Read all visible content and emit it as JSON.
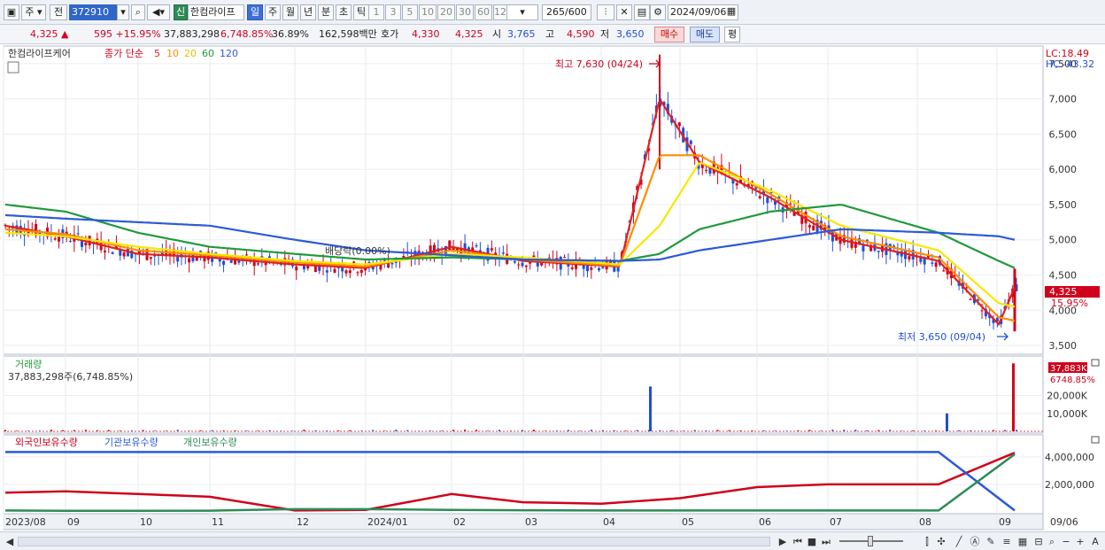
{
  "toolbar": {
    "market_label": "주",
    "prev_label": "전",
    "code": "372910",
    "new_badge": "신",
    "stock_name": "한컴라이프",
    "periods": [
      "일",
      "주",
      "월",
      "년",
      "분",
      "초",
      "틱"
    ],
    "active_period": "일",
    "intervals": [
      "1",
      "3",
      "5",
      "10",
      "20",
      "30",
      "60",
      "120"
    ],
    "count": "265",
    "count_max": "/600",
    "date": "2024/09/06"
  },
  "quote": {
    "price": "4,325",
    "change": "595",
    "change_pct": "+15.95%",
    "volume": "37,883,298",
    "volume_ratio": "6,748.85%",
    "turnover": "36.89%",
    "amount": "162,598백만",
    "bid_label": "호가",
    "bid1": "4,330",
    "bid2": "4,325",
    "open_label": "시",
    "open": "3,765",
    "high_label": "고",
    "high": "4,590",
    "low_label": "저",
    "low": "3,650",
    "buy_label": "매수",
    "sell_label": "매도",
    "avg_label": "평"
  },
  "price_panel": {
    "title": "한컴라이프케어",
    "ma_label": "종가 단순",
    "ma_periods": [
      "5",
      "10",
      "20",
      "60",
      "120"
    ],
    "ma_colors": [
      "#e02020",
      "#ff8c00",
      "#f5e800",
      "#1f9a3a",
      "#2c5ad8"
    ],
    "lc": "LC:18.49",
    "hc": "HC:-43.32",
    "high_note": "최고 7,630 (04/24)",
    "low_note": "최저 3,650 (09/04)",
    "dividend_note": "배당락(0.00%)",
    "current_price_tag": "4,325",
    "current_pct_tag": "15.95%",
    "y_ticks": [
      "7,500",
      "7,000",
      "6,500",
      "6,000",
      "5,500",
      "5,000",
      "4,500",
      "4,000",
      "3,500"
    ]
  },
  "volume_panel": {
    "title": "거래량",
    "subtitle": "37,883,298주(6,748.85%)",
    "tag_value": "37,883K",
    "tag_pct": "6748.85%",
    "y_ticks": [
      "20,000K",
      "10,000K"
    ]
  },
  "holding_panel": {
    "legend": [
      "외국인보유수량",
      "기관보유수량",
      "개인보유수량"
    ],
    "colors": [
      "#d0021b",
      "#2c5ad8",
      "#2e8b57"
    ],
    "y_ticks": [
      "4,000,000",
      "2,000,000"
    ]
  },
  "x_axis": {
    "labels": [
      "2023/08",
      "09",
      "10",
      "11",
      "12",
      "2024/01",
      "02",
      "03",
      "04",
      "05",
      "06",
      "07",
      "08",
      "09"
    ],
    "end_label": "09/06"
  },
  "colors": {
    "up": "#d0021b",
    "down": "#1f4fd8",
    "accent": "#3d6fd6"
  },
  "chart_data": [
    {
      "type": "line",
      "panel": "price",
      "title": "한컴라이프케어",
      "x": [
        "2023/08",
        "09",
        "10",
        "11",
        "12",
        "2024/01",
        "02",
        "03",
        "04",
        "04/24",
        "05",
        "06",
        "07",
        "08",
        "09/04",
        "09/06"
      ],
      "series": [
        {
          "name": "5",
          "values": [
            5200,
            5050,
            4800,
            4750,
            4650,
            4600,
            4900,
            4700,
            4620,
            7000,
            6100,
            5600,
            5000,
            4700,
            3800,
            4325
          ]
        },
        {
          "name": "10",
          "values": [
            5150,
            5080,
            4850,
            4780,
            4680,
            4620,
            4850,
            4720,
            4630,
            6200,
            6200,
            5650,
            5050,
            4750,
            3900,
            3850
          ]
        },
        {
          "name": "20",
          "values": [
            5100,
            5050,
            4900,
            4800,
            4700,
            4650,
            4800,
            4750,
            4650,
            5200,
            6100,
            5700,
            5200,
            4850,
            4100,
            4050
          ]
        },
        {
          "name": "60",
          "values": [
            5500,
            5400,
            5100,
            4900,
            4800,
            4720,
            4750,
            4720,
            4700,
            4800,
            5150,
            5400,
            5500,
            5100,
            4700,
            4600
          ]
        },
        {
          "name": "120",
          "values": [
            5350,
            5300,
            5250,
            5200,
            5000,
            4850,
            4780,
            4720,
            4700,
            4720,
            4850,
            5000,
            5150,
            5100,
            5050,
            5000
          ]
        }
      ],
      "ylim": [
        3400,
        7700
      ],
      "high": 7630,
      "low": 3650,
      "last": 4325
    },
    {
      "type": "bar",
      "panel": "volume",
      "title": "거래량",
      "spikes": [
        {
          "x": "04/24",
          "value": 25000000
        },
        {
          "x": "08",
          "value": 10000000
        },
        {
          "x": "09/06",
          "value": 37883298
        }
      ],
      "ylim": [
        0,
        40000000
      ]
    },
    {
      "type": "line",
      "panel": "holdings",
      "x": [
        "2023/08",
        "09",
        "10",
        "11",
        "12",
        "2024/01",
        "02",
        "03",
        "04",
        "05",
        "06",
        "07",
        "08",
        "09/06"
      ],
      "series": [
        {
          "name": "외국인보유수량",
          "values": [
            1400000,
            1500000,
            1300000,
            1100000,
            100000,
            150000,
            1300000,
            700000,
            600000,
            1000000,
            1800000,
            2000000,
            2000000,
            4300000
          ]
        },
        {
          "name": "기관보유수량",
          "values": [
            4350000,
            4350000,
            4350000,
            4350000,
            4350000,
            4350000,
            4350000,
            4350000,
            4350000,
            4350000,
            4350000,
            4350000,
            4350000,
            100000
          ]
        },
        {
          "name": "개인보유수량",
          "values": [
            100000,
            80000,
            80000,
            90000,
            200000,
            200000,
            150000,
            120000,
            100000,
            100000,
            100000,
            100000,
            100000,
            4200000
          ]
        }
      ],
      "ylim": [
        0,
        4700000
      ]
    }
  ]
}
